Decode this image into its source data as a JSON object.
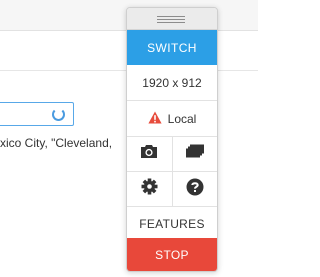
{
  "background": {
    "text_snippet": "xico City, \"Cleveland,"
  },
  "widget": {
    "switch_label": "SWITCH",
    "resolution": "1920 x 912",
    "location_label": "Local",
    "features_label": "FEATURES",
    "stop_label": "STOP",
    "icons": [
      "camera-icon",
      "screens-icon",
      "gear-icon",
      "help-icon",
      "warning-icon"
    ],
    "colors": {
      "switch_bg": "#2c9fe6",
      "stop_bg": "#e8483a",
      "warning": "#e74c3c",
      "icon": "#333333"
    }
  }
}
